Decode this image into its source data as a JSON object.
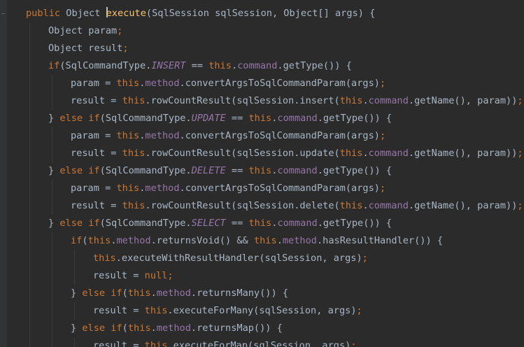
{
  "editor": {
    "theme_colors": {
      "background": "#2b2b2b",
      "keyword": "#cc7832",
      "method_decl": "#ffc66d",
      "field": "#9876aa",
      "plain": "#a9b7c6"
    },
    "lines": [
      {
        "indent": 0,
        "tokens": [
          {
            "t": "public",
            "c": "kw"
          },
          {
            "t": " Object ",
            "c": "plain"
          },
          {
            "t": "|",
            "c": "caret"
          },
          {
            "t": "execute",
            "c": "fn"
          },
          {
            "t": "(SqlSession sqlSession, Object[] args) {",
            "c": "plain"
          }
        ]
      },
      {
        "indent": 1,
        "tokens": [
          {
            "t": "Object param",
            "c": "plain"
          },
          {
            "t": ";",
            "c": "kw"
          }
        ]
      },
      {
        "indent": 1,
        "tokens": [
          {
            "t": "Object result",
            "c": "plain"
          },
          {
            "t": ";",
            "c": "kw"
          }
        ]
      },
      {
        "indent": 1,
        "tokens": [
          {
            "t": "if",
            "c": "kw"
          },
          {
            "t": "(SqlCommandType.",
            "c": "plain"
          },
          {
            "t": "INSERT",
            "c": "const"
          },
          {
            "t": " == ",
            "c": "plain"
          },
          {
            "t": "this",
            "c": "kw"
          },
          {
            "t": ".",
            "c": "plain"
          },
          {
            "t": "command",
            "c": "fld"
          },
          {
            "t": ".getType()) {",
            "c": "plain"
          }
        ]
      },
      {
        "indent": 2,
        "tokens": [
          {
            "t": "param = ",
            "c": "plain"
          },
          {
            "t": "this",
            "c": "kw"
          },
          {
            "t": ".",
            "c": "plain"
          },
          {
            "t": "method",
            "c": "fld"
          },
          {
            "t": ".convertArgsToSqlCommandParam(args)",
            "c": "plain"
          },
          {
            "t": ";",
            "c": "kw"
          }
        ]
      },
      {
        "indent": 2,
        "tokens": [
          {
            "t": "result = ",
            "c": "plain"
          },
          {
            "t": "this",
            "c": "kw"
          },
          {
            "t": ".rowCountResult(sqlSession.insert(",
            "c": "plain"
          },
          {
            "t": "this",
            "c": "kw"
          },
          {
            "t": ".",
            "c": "plain"
          },
          {
            "t": "command",
            "c": "fld"
          },
          {
            "t": ".getName(), param))",
            "c": "plain"
          },
          {
            "t": ";",
            "c": "kw"
          }
        ]
      },
      {
        "indent": 1,
        "tokens": [
          {
            "t": "} ",
            "c": "plain"
          },
          {
            "t": "else if",
            "c": "kw"
          },
          {
            "t": "(SqlCommandType.",
            "c": "plain"
          },
          {
            "t": "UPDATE",
            "c": "const"
          },
          {
            "t": " == ",
            "c": "plain"
          },
          {
            "t": "this",
            "c": "kw"
          },
          {
            "t": ".",
            "c": "plain"
          },
          {
            "t": "command",
            "c": "fld"
          },
          {
            "t": ".getType()) {",
            "c": "plain"
          }
        ]
      },
      {
        "indent": 2,
        "tokens": [
          {
            "t": "param = ",
            "c": "plain"
          },
          {
            "t": "this",
            "c": "kw"
          },
          {
            "t": ".",
            "c": "plain"
          },
          {
            "t": "method",
            "c": "fld"
          },
          {
            "t": ".convertArgsToSqlCommandParam(args)",
            "c": "plain"
          },
          {
            "t": ";",
            "c": "kw"
          }
        ]
      },
      {
        "indent": 2,
        "tokens": [
          {
            "t": "result = ",
            "c": "plain"
          },
          {
            "t": "this",
            "c": "kw"
          },
          {
            "t": ".rowCountResult(sqlSession.update(",
            "c": "plain"
          },
          {
            "t": "this",
            "c": "kw"
          },
          {
            "t": ".",
            "c": "plain"
          },
          {
            "t": "command",
            "c": "fld"
          },
          {
            "t": ".getName(), param))",
            "c": "plain"
          },
          {
            "t": ";",
            "c": "kw"
          }
        ]
      },
      {
        "indent": 1,
        "tokens": [
          {
            "t": "} ",
            "c": "plain"
          },
          {
            "t": "else if",
            "c": "kw"
          },
          {
            "t": "(SqlCommandType.",
            "c": "plain"
          },
          {
            "t": "DELETE",
            "c": "const"
          },
          {
            "t": " == ",
            "c": "plain"
          },
          {
            "t": "this",
            "c": "kw"
          },
          {
            "t": ".",
            "c": "plain"
          },
          {
            "t": "command",
            "c": "fld"
          },
          {
            "t": ".getType()) {",
            "c": "plain"
          }
        ]
      },
      {
        "indent": 2,
        "tokens": [
          {
            "t": "param = ",
            "c": "plain"
          },
          {
            "t": "this",
            "c": "kw"
          },
          {
            "t": ".",
            "c": "plain"
          },
          {
            "t": "method",
            "c": "fld"
          },
          {
            "t": ".convertArgsToSqlCommandParam(args)",
            "c": "plain"
          },
          {
            "t": ";",
            "c": "kw"
          }
        ]
      },
      {
        "indent": 2,
        "tokens": [
          {
            "t": "result = ",
            "c": "plain"
          },
          {
            "t": "this",
            "c": "kw"
          },
          {
            "t": ".rowCountResult(sqlSession.delete(",
            "c": "plain"
          },
          {
            "t": "this",
            "c": "kw"
          },
          {
            "t": ".",
            "c": "plain"
          },
          {
            "t": "command",
            "c": "fld"
          },
          {
            "t": ".getName(), param))",
            "c": "plain"
          },
          {
            "t": ";",
            "c": "kw"
          }
        ]
      },
      {
        "indent": 1,
        "tokens": [
          {
            "t": "} ",
            "c": "plain"
          },
          {
            "t": "else if",
            "c": "kw"
          },
          {
            "t": "(SqlCommandType.",
            "c": "plain"
          },
          {
            "t": "SELECT",
            "c": "const"
          },
          {
            "t": " == ",
            "c": "plain"
          },
          {
            "t": "this",
            "c": "kw"
          },
          {
            "t": ".",
            "c": "plain"
          },
          {
            "t": "command",
            "c": "fld"
          },
          {
            "t": ".getType()) {",
            "c": "plain"
          }
        ]
      },
      {
        "indent": 2,
        "tokens": [
          {
            "t": "if",
            "c": "kw"
          },
          {
            "t": "(",
            "c": "plain"
          },
          {
            "t": "this",
            "c": "kw"
          },
          {
            "t": ".",
            "c": "plain"
          },
          {
            "t": "method",
            "c": "fld"
          },
          {
            "t": ".returnsVoid() && ",
            "c": "plain"
          },
          {
            "t": "this",
            "c": "kw"
          },
          {
            "t": ".",
            "c": "plain"
          },
          {
            "t": "method",
            "c": "fld"
          },
          {
            "t": ".hasResultHandler()) {",
            "c": "plain"
          }
        ]
      },
      {
        "indent": 3,
        "tokens": [
          {
            "t": "this",
            "c": "kw"
          },
          {
            "t": ".executeWithResultHandler(sqlSession, args)",
            "c": "plain"
          },
          {
            "t": ";",
            "c": "kw"
          }
        ]
      },
      {
        "indent": 3,
        "tokens": [
          {
            "t": "result = ",
            "c": "plain"
          },
          {
            "t": "null",
            "c": "kw"
          },
          {
            "t": ";",
            "c": "kw"
          }
        ]
      },
      {
        "indent": 2,
        "tokens": [
          {
            "t": "} ",
            "c": "plain"
          },
          {
            "t": "else if",
            "c": "kw"
          },
          {
            "t": "(",
            "c": "plain"
          },
          {
            "t": "this",
            "c": "kw"
          },
          {
            "t": ".",
            "c": "plain"
          },
          {
            "t": "method",
            "c": "fld"
          },
          {
            "t": ".returnsMany()) {",
            "c": "plain"
          }
        ]
      },
      {
        "indent": 3,
        "tokens": [
          {
            "t": "result = ",
            "c": "plain"
          },
          {
            "t": "this",
            "c": "kw"
          },
          {
            "t": ".executeForMany(sqlSession, args)",
            "c": "plain"
          },
          {
            "t": ";",
            "c": "kw"
          }
        ]
      },
      {
        "indent": 2,
        "tokens": [
          {
            "t": "} ",
            "c": "plain"
          },
          {
            "t": "else if",
            "c": "kw"
          },
          {
            "t": "(",
            "c": "plain"
          },
          {
            "t": "this",
            "c": "kw"
          },
          {
            "t": ".",
            "c": "plain"
          },
          {
            "t": "method",
            "c": "fld"
          },
          {
            "t": ".returnsMap()) {",
            "c": "plain"
          }
        ]
      },
      {
        "indent": 3,
        "tokens": [
          {
            "t": "result = ",
            "c": "plain"
          },
          {
            "t": "this",
            "c": "kw"
          },
          {
            "t": ".executeForMap(sqlSession, args)",
            "c": "plain"
          },
          {
            "t": ";",
            "c": "kw"
          }
        ]
      }
    ]
  }
}
